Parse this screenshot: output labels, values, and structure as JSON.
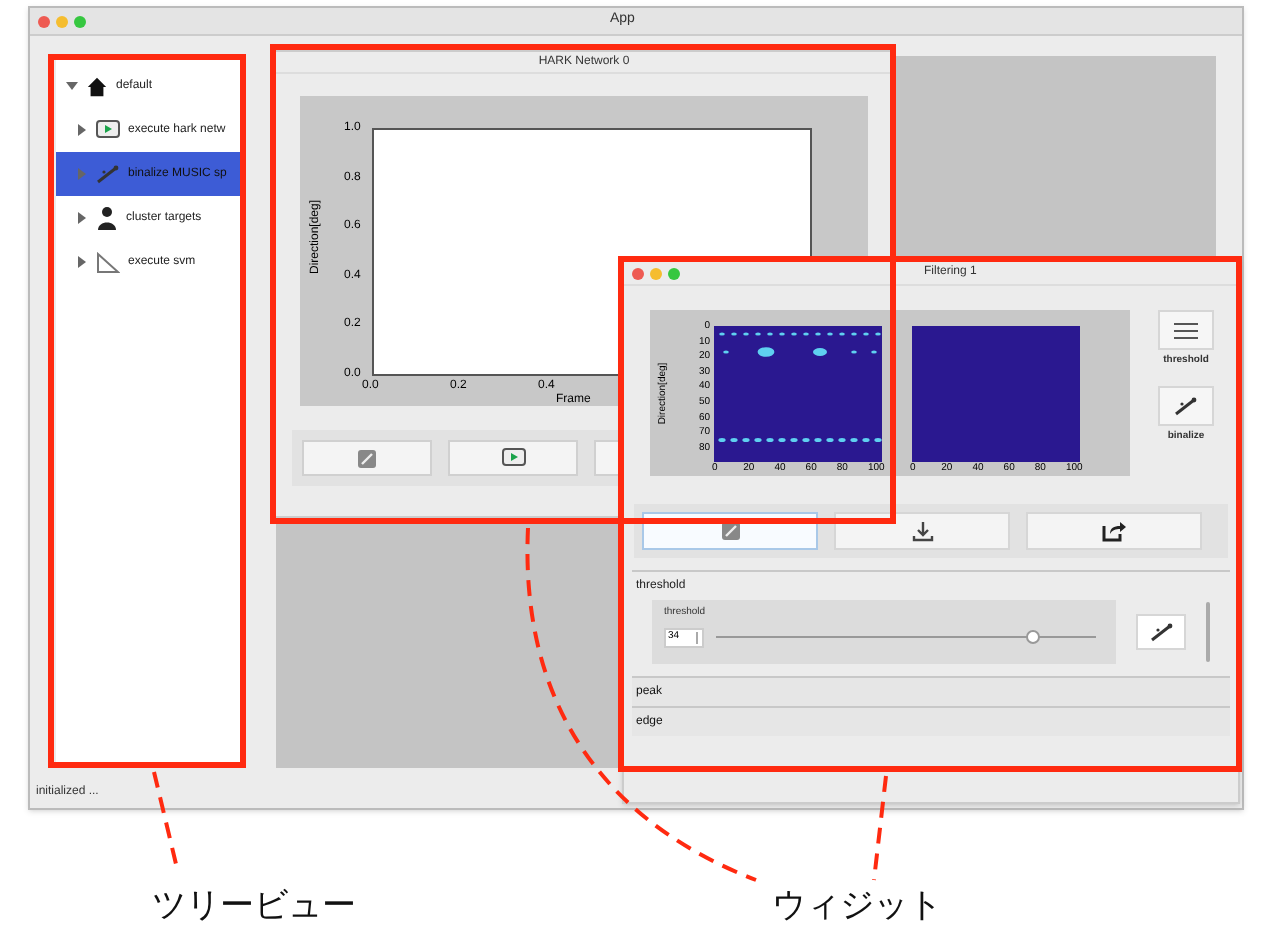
{
  "window": {
    "title": "App"
  },
  "tree": [
    {
      "label": "default",
      "kind": "home",
      "expanded": true,
      "selected": false,
      "children": [
        {
          "label": "execute hark netw",
          "kind": "play",
          "expanded": false,
          "selected": false
        },
        {
          "label": "binalize MUSIC sp",
          "kind": "wand",
          "expanded": false,
          "selected": true
        },
        {
          "label": "cluster targets",
          "kind": "person",
          "expanded": false,
          "selected": false
        },
        {
          "label": "execute svm",
          "kind": "ruler",
          "expanded": false,
          "selected": false
        }
      ]
    }
  ],
  "status_bar": "initialized ...",
  "hark_window": {
    "title": "HARK Network 0",
    "plot": {
      "ylabel": "Direction[deg]",
      "xlabel": "Frame",
      "yticks": [
        "1.0",
        "0.8",
        "0.6",
        "0.4",
        "0.2",
        "0.0"
      ],
      "xticks": [
        "0.0",
        "0.2",
        "0.4"
      ]
    },
    "buttons": [
      {
        "kind": "edit"
      },
      {
        "kind": "play"
      },
      {
        "kind": "blank"
      }
    ]
  },
  "filter_window": {
    "title": "Filtering 1",
    "heatmap_ylabel": "Direction[deg]",
    "heatmap_yticks": [
      "0",
      "10",
      "20",
      "30",
      "40",
      "50",
      "60",
      "70",
      "80"
    ],
    "heatmaps": [
      {
        "kind": "dots",
        "xticks": [
          "0",
          "20",
          "40",
          "60",
          "80",
          "100"
        ]
      },
      {
        "kind": "empty",
        "xticks": [
          "0",
          "20",
          "40",
          "60",
          "80",
          "100"
        ]
      }
    ],
    "side_buttons": [
      {
        "kind": "lines",
        "label": "threshold"
      },
      {
        "kind": "wand",
        "label": "binalize"
      }
    ],
    "toolbar": [
      {
        "kind": "edit",
        "selected": true
      },
      {
        "kind": "download",
        "selected": false
      },
      {
        "kind": "export",
        "selected": false
      }
    ],
    "sections": [
      {
        "title": "threshold",
        "expanded": true,
        "group": "threshold",
        "value": "34",
        "level": 0.83
      },
      {
        "title": "peak",
        "expanded": false
      },
      {
        "title": "edge",
        "expanded": false
      }
    ]
  },
  "annotations": [
    {
      "label": "ツリービュー"
    },
    {
      "label": "ウィジット"
    }
  ]
}
